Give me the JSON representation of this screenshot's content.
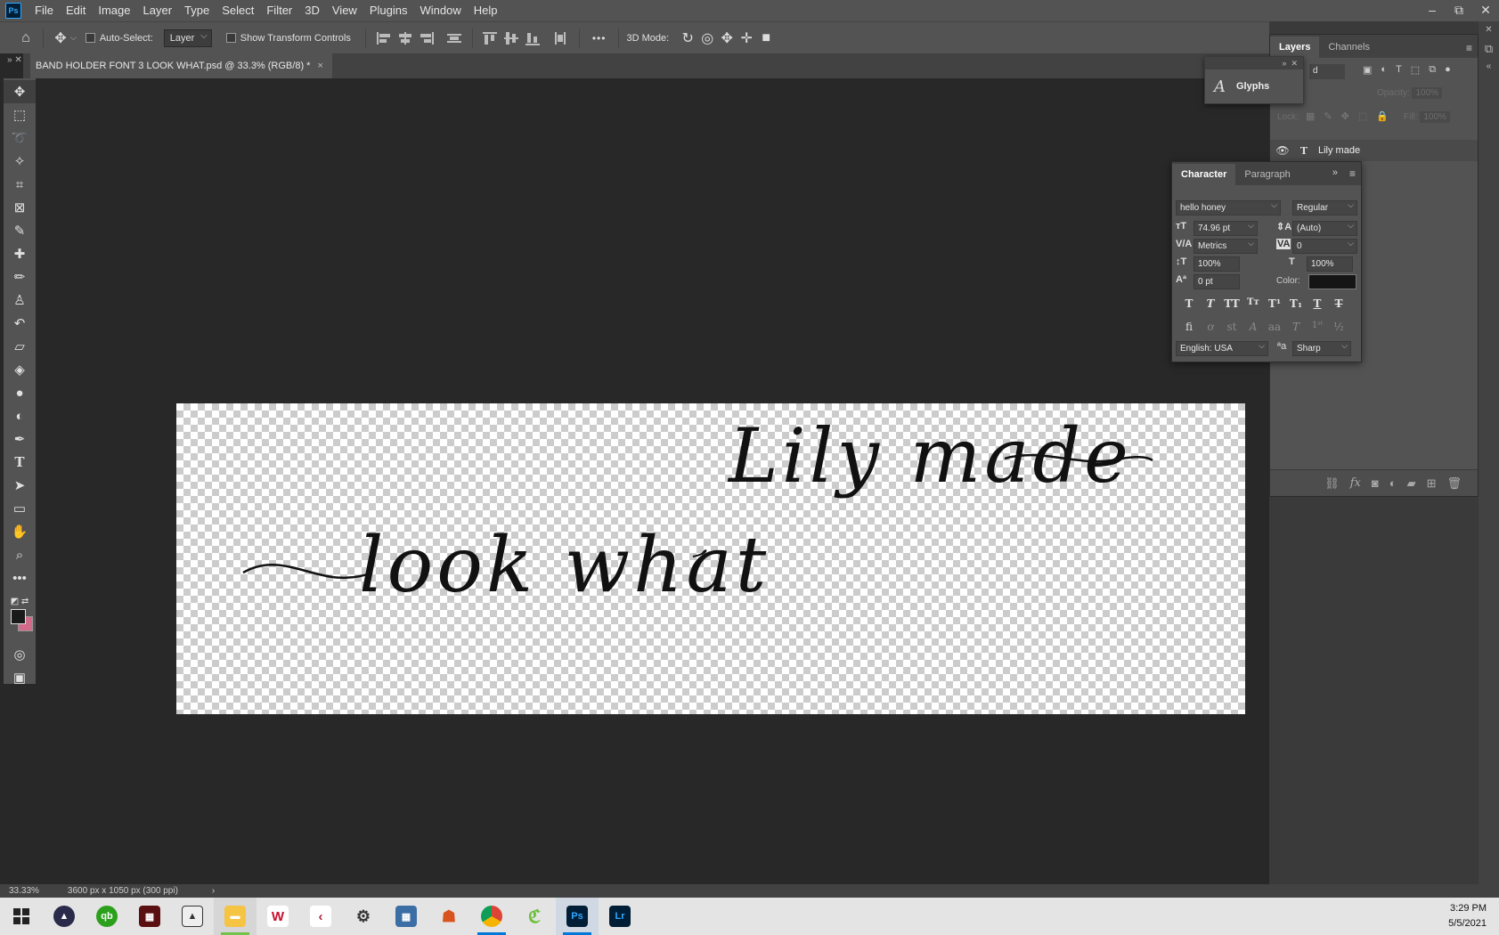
{
  "app": {
    "logo_text": "Ps"
  },
  "menu": [
    "File",
    "Edit",
    "Image",
    "Layer",
    "Type",
    "Select",
    "Filter",
    "3D",
    "View",
    "Plugins",
    "Window",
    "Help"
  ],
  "window_controls": [
    "–",
    "⧉",
    "✕"
  ],
  "options_bar": {
    "auto_select_label": "Auto-Select:",
    "auto_select_target": "Layer",
    "show_transform_label": "Show Transform Controls",
    "more_label": "•••",
    "mode_3d_label": "3D Mode:"
  },
  "document": {
    "tab_title": "BAND HOLDER FONT 3 LOOK WHAT.psd @ 33.3% (RGB/8) *",
    "close_glyph": "×"
  },
  "canvas": {
    "text_upper": "Lily made",
    "text_lower": "look what"
  },
  "layers_panel": {
    "tabs": [
      "Layers",
      "Channels"
    ],
    "filter_value": "d",
    "opacity_label": "Opacity:",
    "opacity_value": "100%",
    "lock_label": "Lock:",
    "fill_label": "Fill:",
    "fill_value": "100%",
    "layer_name": "Lily made"
  },
  "glyphs_panel": {
    "label": "Glyphs",
    "glyph": "A"
  },
  "character_panel": {
    "tabs": [
      "Character",
      "Paragraph"
    ],
    "font_family": "hello honey",
    "font_style": "Regular",
    "font_size": "74.96 pt",
    "leading": "(Auto)",
    "kerning": "Metrics",
    "tracking": "0",
    "vertical_scale": "100%",
    "horizontal_scale": "100%",
    "baseline_shift": "0 pt",
    "color_label": "Color:",
    "language": "English: USA",
    "antialias": "Sharp",
    "color_value": "#151515"
  },
  "status": {
    "zoom": "33.33%",
    "doc_size": "3600 px x 1050 px (300 ppi)",
    "arrow": "›"
  },
  "taskbar": {
    "time": "3:29 PM",
    "date": "5/5/2021",
    "lr_label": "Lr",
    "ps_label": "Ps"
  }
}
